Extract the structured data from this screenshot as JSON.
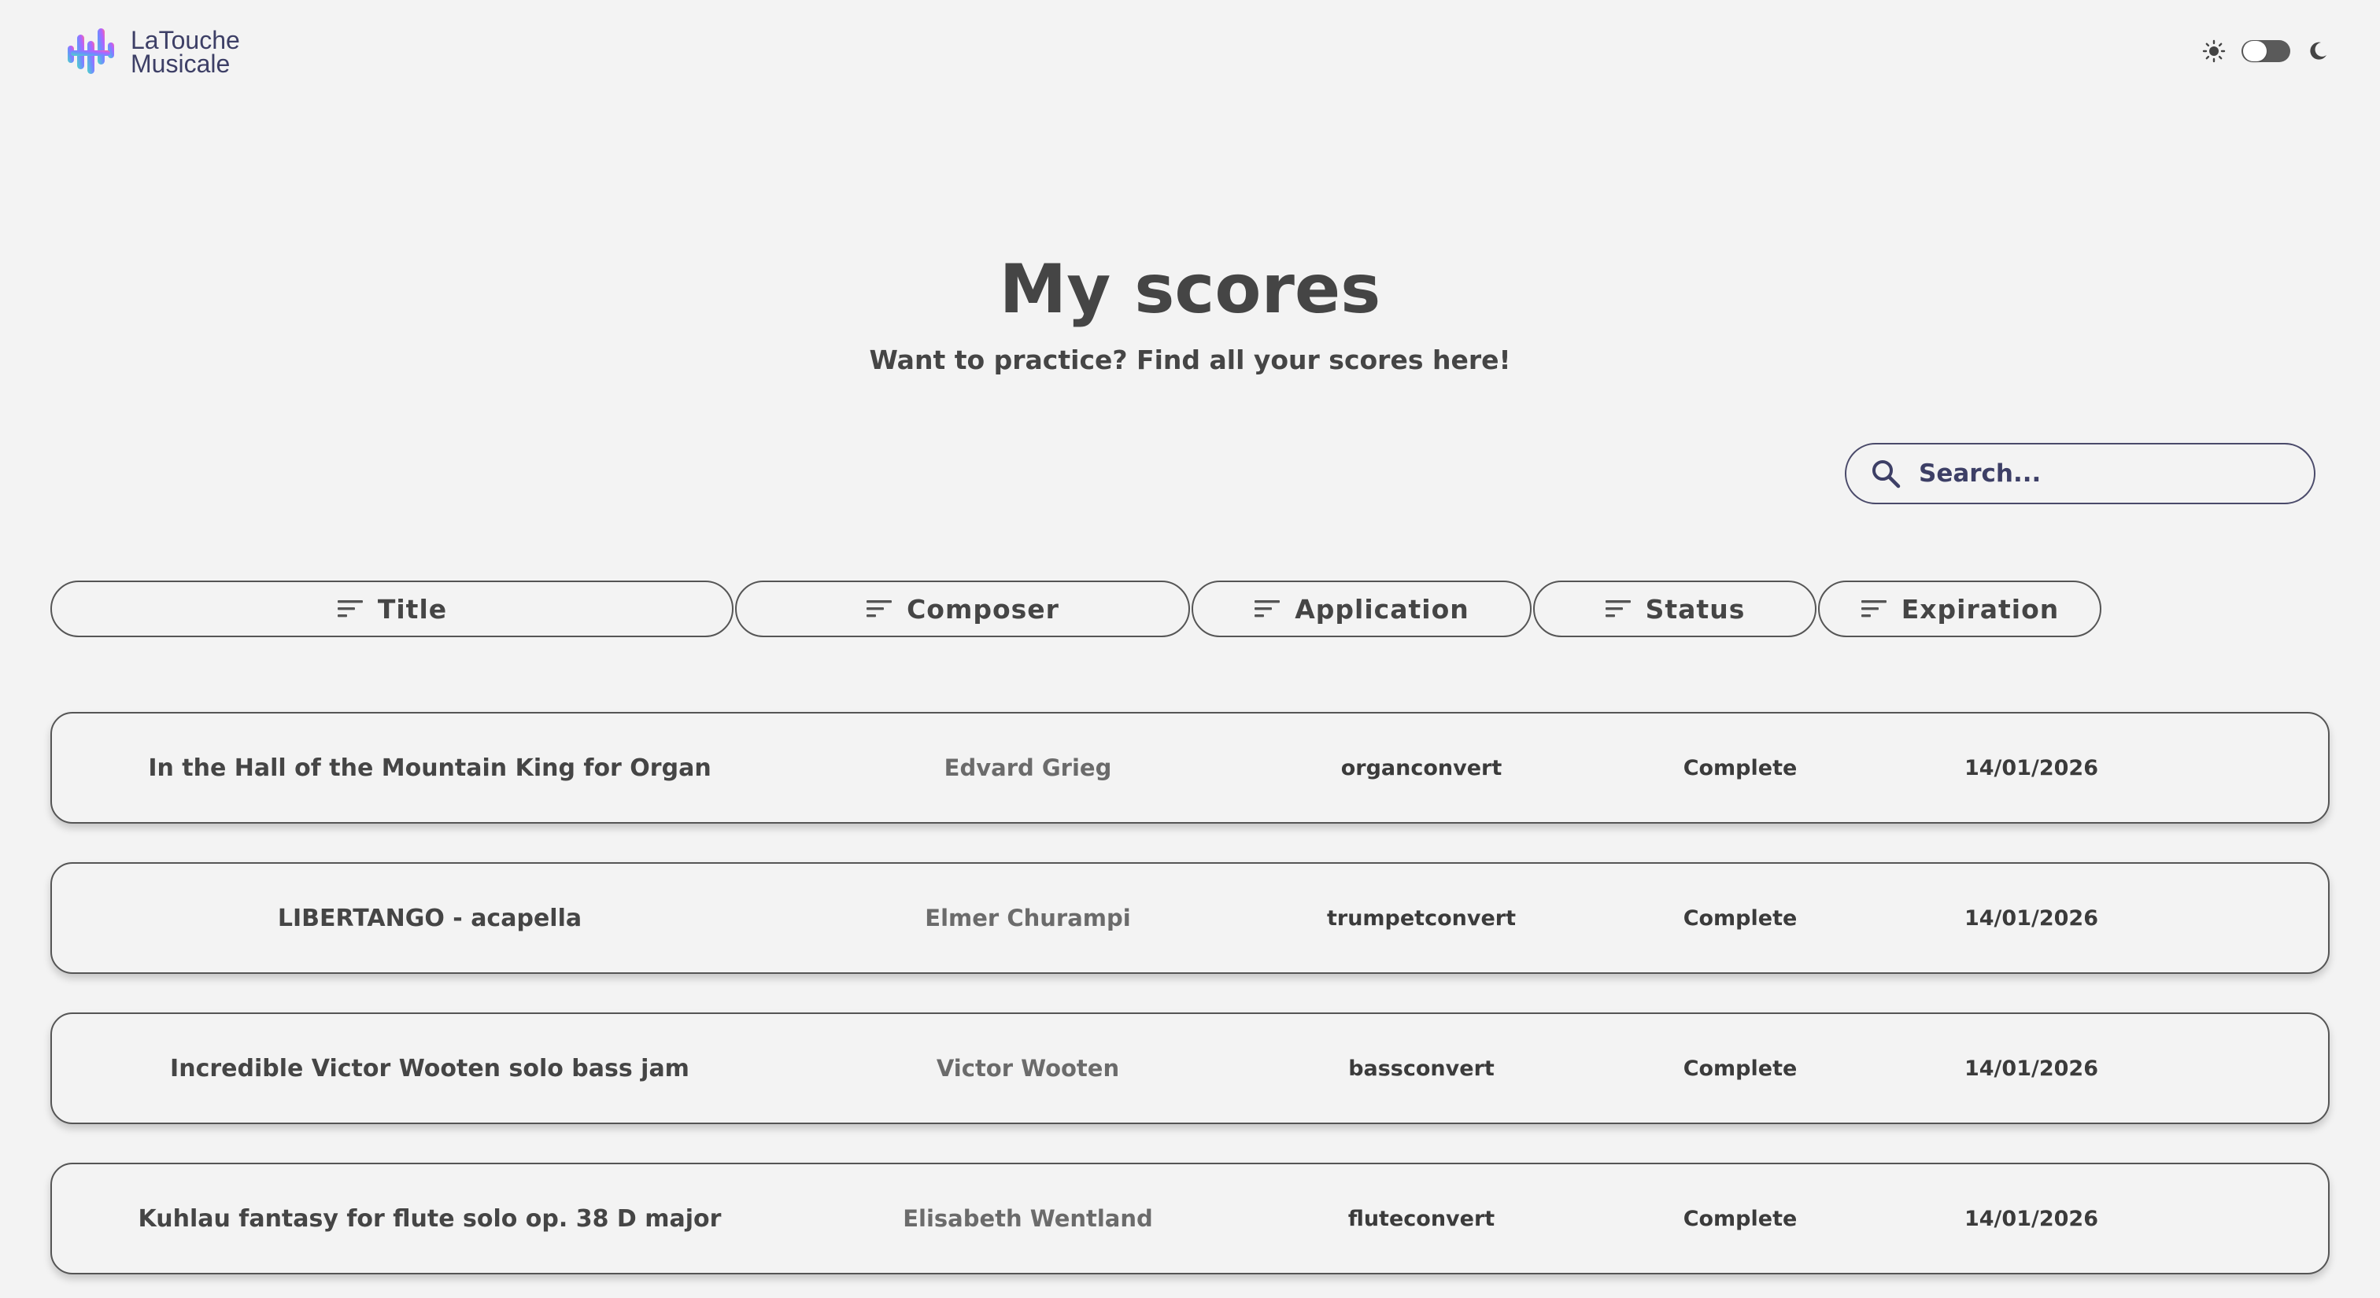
{
  "header": {
    "logo_line1": "LaTouche",
    "logo_line2": "Musicale",
    "logo_colors": [
      "#6f8cff",
      "#b561ff",
      "#ff6f91",
      "#4cd6c8"
    ]
  },
  "theme_toggle": {
    "light_icon": "sun-icon",
    "dark_icon": "moon-icon",
    "mode": "light"
  },
  "hero": {
    "title": "My scores",
    "subtitle": "Want to practice? Find all your scores here!"
  },
  "search": {
    "placeholder": "Search...",
    "value": "",
    "icon": "search-icon"
  },
  "columns": [
    {
      "label": "Title",
      "icon": "sort-icon"
    },
    {
      "label": "Composer",
      "icon": "sort-icon"
    },
    {
      "label": "Application",
      "icon": "sort-icon"
    },
    {
      "label": "Status",
      "icon": "sort-icon"
    },
    {
      "label": "Expiration",
      "icon": "sort-icon"
    }
  ],
  "scores": [
    {
      "title": "In the Hall of the Mountain King for Organ",
      "composer": "Edvard Grieg",
      "application": "organconvert",
      "status": "Complete",
      "expiration": "14/01/2026"
    },
    {
      "title": "LIBERTANGO - acapella",
      "composer": "Elmer Churampi",
      "application": "trumpetconvert",
      "status": "Complete",
      "expiration": "14/01/2026"
    },
    {
      "title": "Incredible Victor Wooten solo bass jam",
      "composer": "Victor Wooten",
      "application": "bassconvert",
      "status": "Complete",
      "expiration": "14/01/2026"
    },
    {
      "title": "Kuhlau fantasy for flute solo op. 38 D major",
      "composer": "Elisabeth Wentland",
      "application": "fluteconvert",
      "status": "Complete",
      "expiration": "14/01/2026"
    }
  ],
  "colors": {
    "background": "#f3f3f3",
    "text": "#454545",
    "accent": "#3d3f66",
    "border": "#555555"
  }
}
